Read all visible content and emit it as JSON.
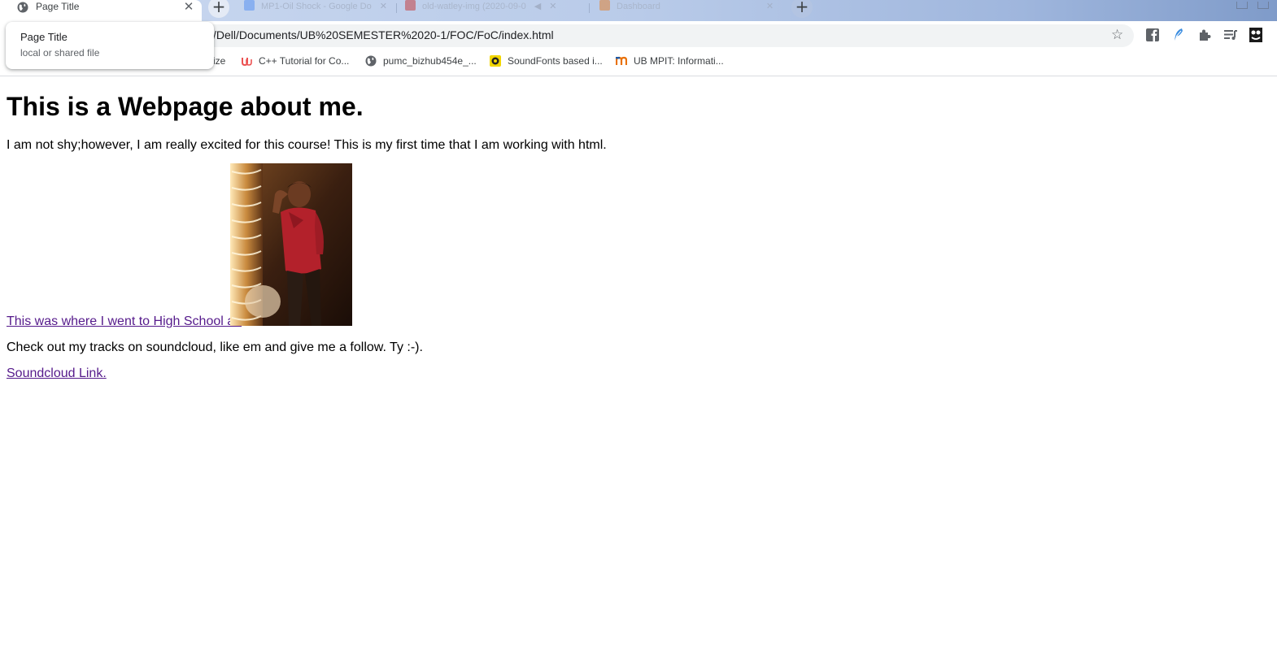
{
  "browser": {
    "active_tab": {
      "title": "Page Title",
      "close_glyph": "✕",
      "icon": "globe-icon"
    },
    "new_tab_glyph": "+",
    "background_tabs": [
      {
        "label": "MP1-Oil Shock - Google Do"
      },
      {
        "label": "old-watley-img (2020-09-0"
      },
      {
        "label": "Dashboard"
      }
    ],
    "address_bar": {
      "url": "/Dell/Documents/UB%20SEMESTER%2020-1/FOC/FoC/index.html",
      "star_glyph": "☆"
    },
    "extensions": [
      "facebook-icon",
      "feather-icon",
      "puzzle-icon",
      "reading-list-icon",
      "avatar-icon"
    ],
    "bookmarks": [
      {
        "label": "ize",
        "icon": "none"
      },
      {
        "label": "C++ Tutorial for Co...",
        "icon": "udemy-icon",
        "color": "#ec5252"
      },
      {
        "label": "pumc_bizhub454e_...",
        "icon": "globe-icon",
        "color": "#5f6368"
      },
      {
        "label": "SoundFonts based i...",
        "icon": "soundfont-icon",
        "color": "#f2d600"
      },
      {
        "label": "UB MPIT: Informati...",
        "icon": "m-logo-icon",
        "color": "#e8710a"
      }
    ],
    "hover_card": {
      "title": "Page Title",
      "subtitle": "local or shared file"
    }
  },
  "page": {
    "heading": "This is a Webpage about me.",
    "intro": "I am not shy;however, I am really excited for this course! This is my first time that I am working with html.",
    "high_school_link": "This was where I went to High School at.",
    "photo": "portrait photo of a young man in a red shirt",
    "soundcloud_text": "Check out my tracks on soundcloud, like em and give me a follow. Ty :-).",
    "soundcloud_link": "Soundcloud Link."
  },
  "colors": {
    "visited_link": "#551a8b",
    "tabstrip": "#cbd9f0",
    "omnibox": "#f1f3f4"
  }
}
